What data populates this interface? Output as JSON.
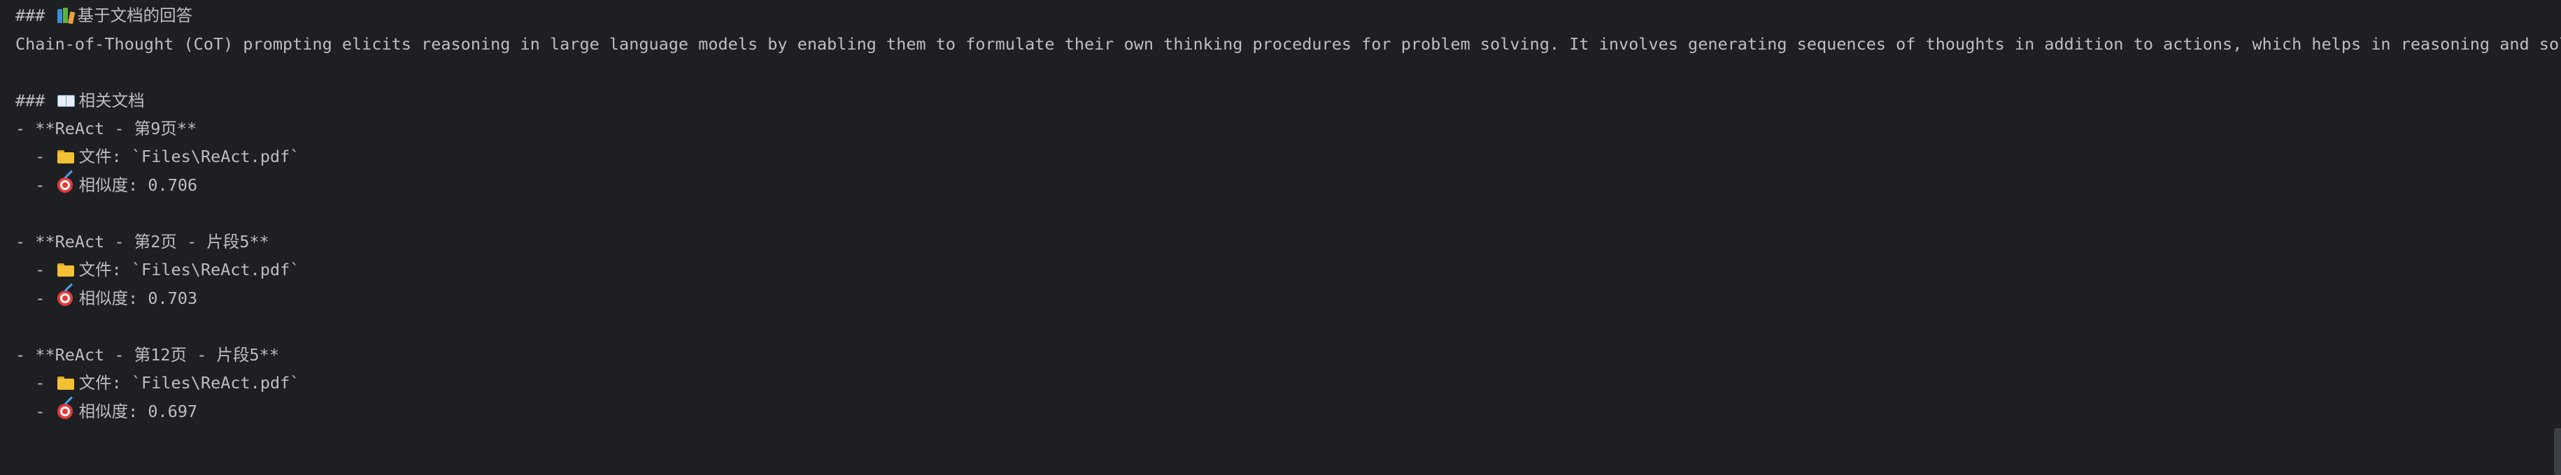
{
  "console": {
    "heading": {
      "prefix": "###",
      "icon": "books-icon",
      "text": "基于文档的回答"
    },
    "answer_text": "Chain-of-Thought (CoT) prompting elicits reasoning in large language models by enabling them to formulate their own thinking procedures for problem solving. It involves generating sequences of thoughts in addition to actions, which helps in reasoning and solving complex tasks.",
    "docs_heading": {
      "prefix": "###",
      "icon": "open-book-icon",
      "text": "相关文档"
    },
    "documents": [
      {
        "title": "- **ReAct - 第9页**",
        "file_prefix": "  -",
        "file_label": "文件: `Files\\ReAct.pdf`",
        "sim_prefix": "  -",
        "sim_label": "相似度: 0.706"
      },
      {
        "title": "- **ReAct - 第2页 - 片段5**",
        "file_prefix": "  -",
        "file_label": "文件: `Files\\ReAct.pdf`",
        "sim_prefix": "  -",
        "sim_label": "相似度: 0.703"
      },
      {
        "title": "- **ReAct - 第12页 - 片段5**",
        "file_prefix": "  -",
        "file_label": "文件: `Files\\ReAct.pdf`",
        "sim_prefix": "  -",
        "sim_label": "相似度: 0.697"
      }
    ],
    "icons": {
      "file": "folder-icon",
      "similarity": "target-icon"
    },
    "colors": {
      "background": "#1e1f22",
      "text": "#bcbec4"
    }
  }
}
